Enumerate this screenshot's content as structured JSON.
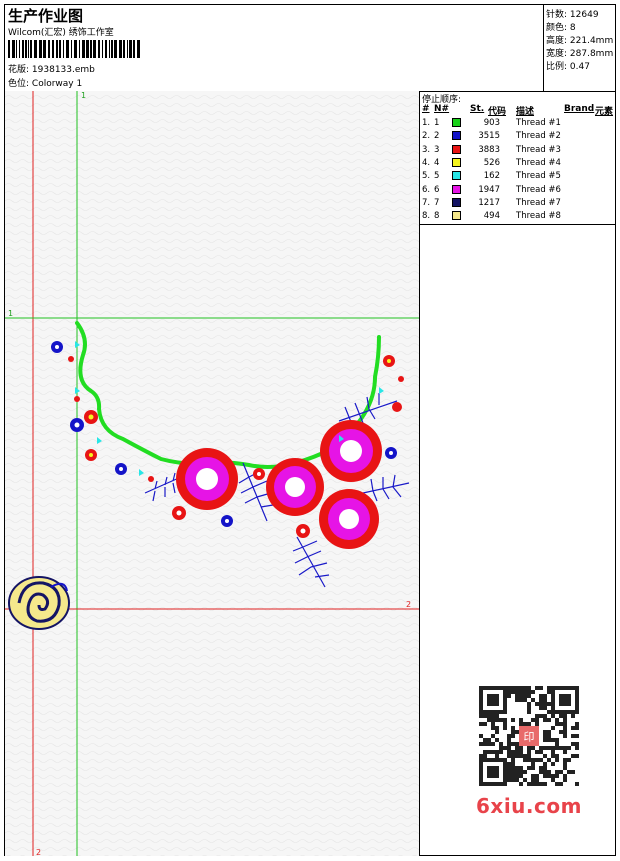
{
  "header": {
    "title": "生产作业图",
    "company": "Wilcom(汇宏) 绣饰工作室",
    "file_label": "花版:",
    "file_value": "1938133.emb",
    "color_label": "色位:",
    "color_value": "Colorway 1"
  },
  "stats": {
    "stitches_label": "针数:",
    "stitches_value": "12649",
    "colors_label": "颜色:",
    "colors_value": "8",
    "height_label": "高度:",
    "height_value": "221.4mm",
    "width_label": "宽度:",
    "width_value": "287.8mm",
    "scale_label": "比例:",
    "scale_value": "0.47"
  },
  "sequence": {
    "title": "停止顺序:",
    "columns": [
      "#",
      "N#",
      "St.",
      "代码",
      "描述",
      "Brand",
      "元素"
    ],
    "rows": [
      {
        "num": "1.",
        "n": "1",
        "color": "#19d219",
        "stitches": "903",
        "desc": "Thread #1"
      },
      {
        "num": "2.",
        "n": "2",
        "color": "#1414c8",
        "stitches": "3515",
        "desc": "Thread #2"
      },
      {
        "num": "3.",
        "n": "3",
        "color": "#e81414",
        "stitches": "3883",
        "desc": "Thread #3"
      },
      {
        "num": "4.",
        "n": "4",
        "color": "#f5f51e",
        "stitches": "526",
        "desc": "Thread #4"
      },
      {
        "num": "5.",
        "n": "5",
        "color": "#28e6e6",
        "stitches": "162",
        "desc": "Thread #5"
      },
      {
        "num": "6.",
        "n": "6",
        "color": "#e614e6",
        "stitches": "1947",
        "desc": "Thread #6"
      },
      {
        "num": "7.",
        "n": "7",
        "color": "#141464",
        "stitches": "1217",
        "desc": "Thread #7"
      },
      {
        "num": "8.",
        "n": "8",
        "color": "#f5e88c",
        "stitches": "494",
        "desc": "Thread #8"
      }
    ]
  },
  "guides": {
    "v1_label": "1",
    "h1_label": "1",
    "h2_label": "2",
    "v2_label": "2"
  },
  "watermark": "6xiu.com",
  "qr_stamp": "印"
}
